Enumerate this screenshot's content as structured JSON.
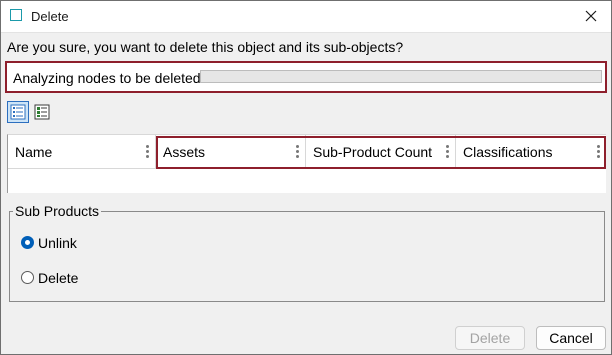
{
  "window": {
    "title": "Delete"
  },
  "question": "Are you sure, you want to delete this object and its sub-objects?",
  "analysis": {
    "text": "Analyzing nodes to be deleted.",
    "progress": 0
  },
  "view_toggle": {
    "list_icon": "list-view-icon",
    "detail_icon": "details-view-icon"
  },
  "grid": {
    "columns": [
      "Name",
      "Assets",
      "Sub-Product Count",
      "Classifications"
    ]
  },
  "sub_products": {
    "legend": "Sub Products",
    "options": [
      {
        "label": "Unlink",
        "checked": true
      },
      {
        "label": "Delete",
        "checked": false
      }
    ]
  },
  "buttons": {
    "delete": "Delete",
    "cancel": "Cancel"
  },
  "colors": {
    "highlight": "#8e1f2c",
    "accent": "#005fb8"
  }
}
